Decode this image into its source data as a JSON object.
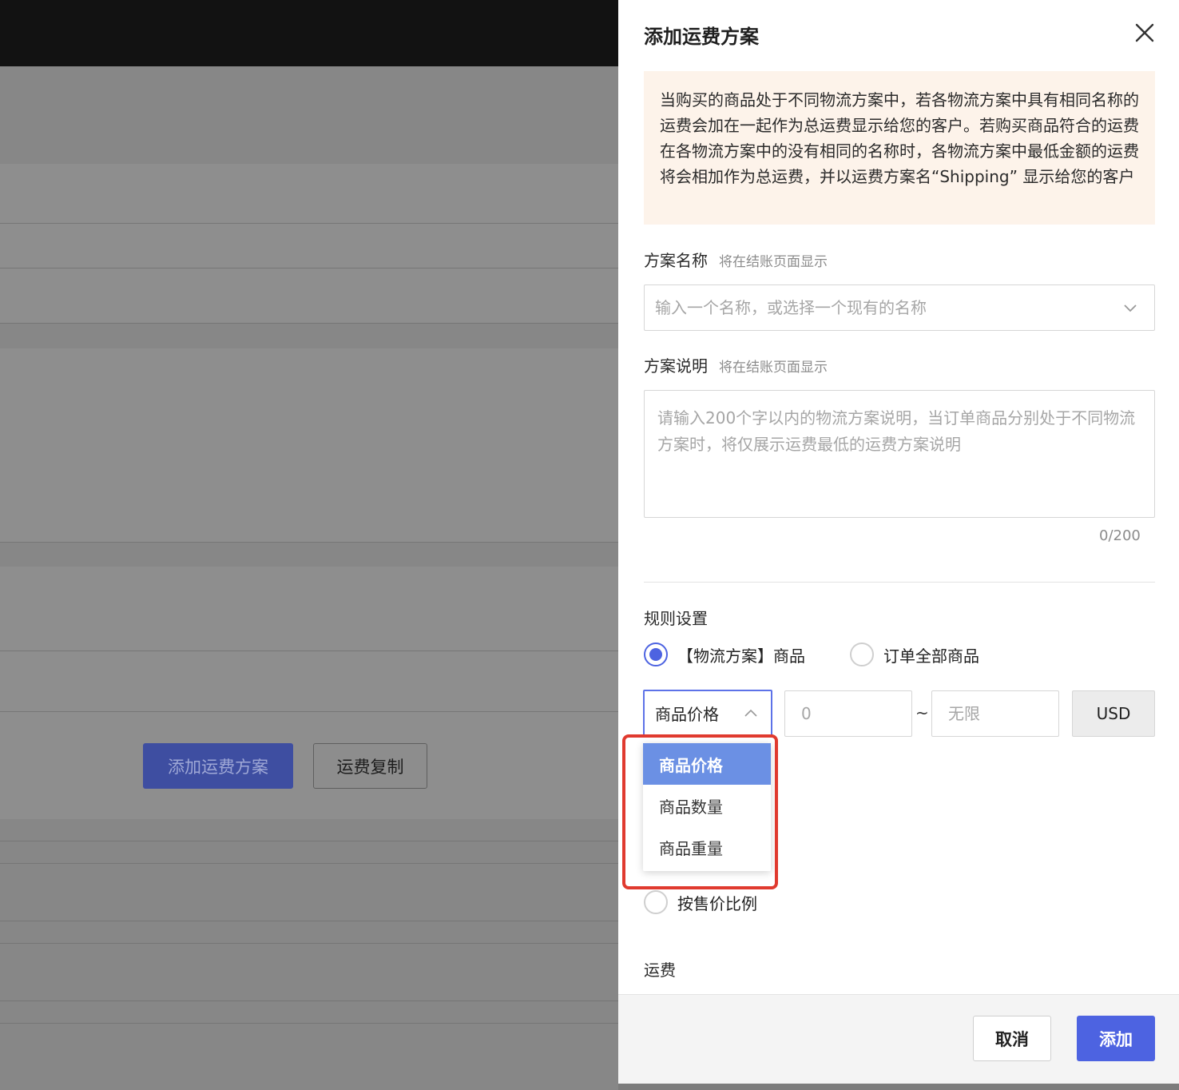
{
  "background": {
    "primary_button": "添加运费方案",
    "secondary_button": "运费复制"
  },
  "drawer": {
    "title": "添加运费方案",
    "close_icon": "close-icon",
    "notice": "当购买的商品处于不同物流方案中，若各物流方案中具有相同名称的运费会加在一起作为总运费显示给您的客户。若购买商品符合的运费在各物流方案中的没有相同的名称时，各物流方案中最低金额的运费将会相加作为总运费，并以运费方案名“Shipping” 显示给您的客户",
    "plan_name": {
      "label": "方案名称",
      "hint": "将在结账页面显示",
      "placeholder": "输入一个名称，或选择一个现有的名称"
    },
    "plan_desc": {
      "label": "方案说明",
      "hint": "将在结账页面显示",
      "placeholder": "请输入200个字以内的物流方案说明，当订单商品分别处于不同物流方案时，将仅展示运费最低的运费方案说明",
      "counter": "0/200"
    },
    "rules": {
      "label": "规则设置",
      "radio_plan_goods": "【物流方案】商品",
      "radio_all_goods": "订单全部商品",
      "condition_selected": "商品价格",
      "min_placeholder": "0",
      "tilde": "~",
      "max_placeholder": "无限",
      "currency": "USD",
      "options": [
        "商品价格",
        "商品数量",
        "商品重量"
      ],
      "radio_by_price_ratio": "按售价比例"
    },
    "fee_label": "运费",
    "footer": {
      "cancel": "取消",
      "add": "添加"
    }
  },
  "colors": {
    "primary": "#4d63e1",
    "notice_bg": "#fdf3ea",
    "dropdown_active": "#6b90e4",
    "highlight": "#e03a2f"
  }
}
